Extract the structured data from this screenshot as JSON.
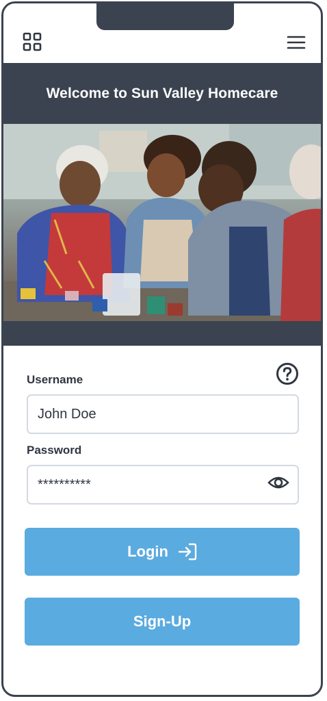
{
  "header": {
    "title": "Welcome to Sun Valley Homecare"
  },
  "icons": {
    "grid": "grid-icon",
    "menu": "hamburger-menu-icon",
    "help": "question-circle-icon",
    "password_toggle": "eye-icon",
    "login": "sign-in-arrow-icon"
  },
  "form": {
    "username_label": "Username",
    "username_value": "John Doe",
    "password_label": "Password",
    "password_value": "**********"
  },
  "buttons": {
    "login": "Login",
    "signup": "Sign-Up"
  },
  "colors": {
    "dark": "#3b4350",
    "accent": "#5aabdf",
    "field_border": "#d3d9e2"
  }
}
